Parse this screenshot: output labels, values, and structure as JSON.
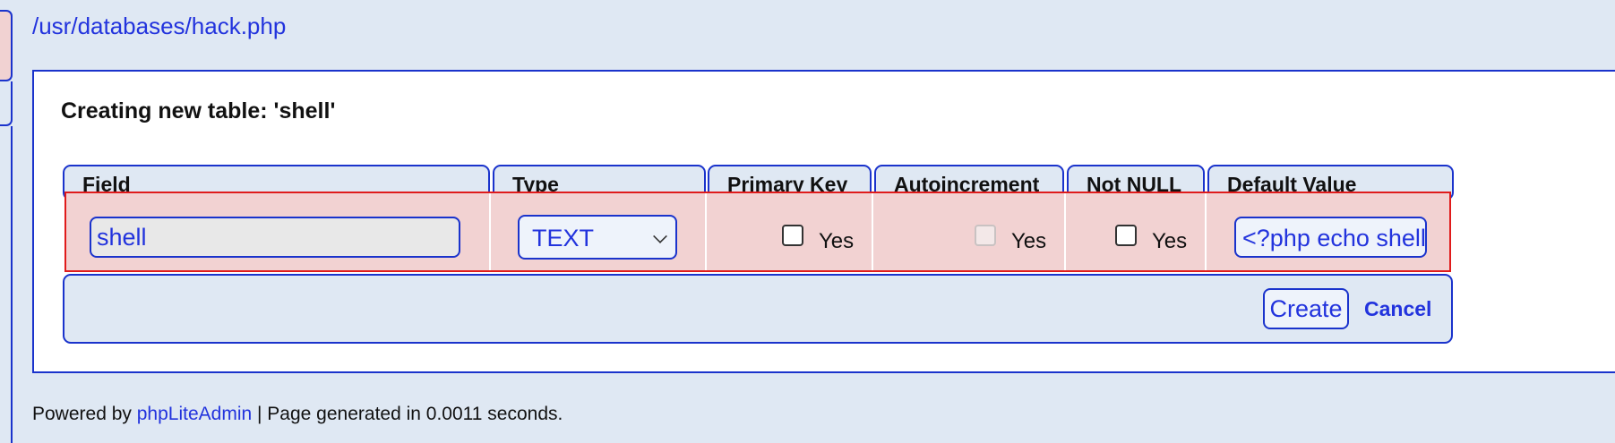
{
  "breadcrumb": {
    "path": "/usr/databases/hack.php"
  },
  "panel": {
    "title": "Creating new table: 'shell'"
  },
  "table": {
    "headers": [
      "Field",
      "Type",
      "Primary Key",
      "Autoincrement",
      "Not NULL",
      "Default Value"
    ],
    "row": {
      "field_value": "shell",
      "type_value": "TEXT",
      "primary_key_label": "Yes",
      "primary_key_checked": false,
      "autoincrement_label": "Yes",
      "autoincrement_checked": false,
      "autoincrement_disabled": true,
      "not_null_label": "Yes",
      "not_null_checked": false,
      "default_value": "<?php echo shell"
    }
  },
  "actions": {
    "create_label": "Create",
    "cancel_label": "Cancel"
  },
  "footer": {
    "prefix": "Powered by",
    "link_text": "phpLiteAdmin",
    "suffix": " | Page generated in 0.0011 seconds."
  },
  "colors": {
    "accent": "#1a33cc",
    "link": "#2233dd",
    "row_highlight": "#f2d2d2",
    "row_border": "#e01b1b",
    "background": "#dfe8f3"
  }
}
